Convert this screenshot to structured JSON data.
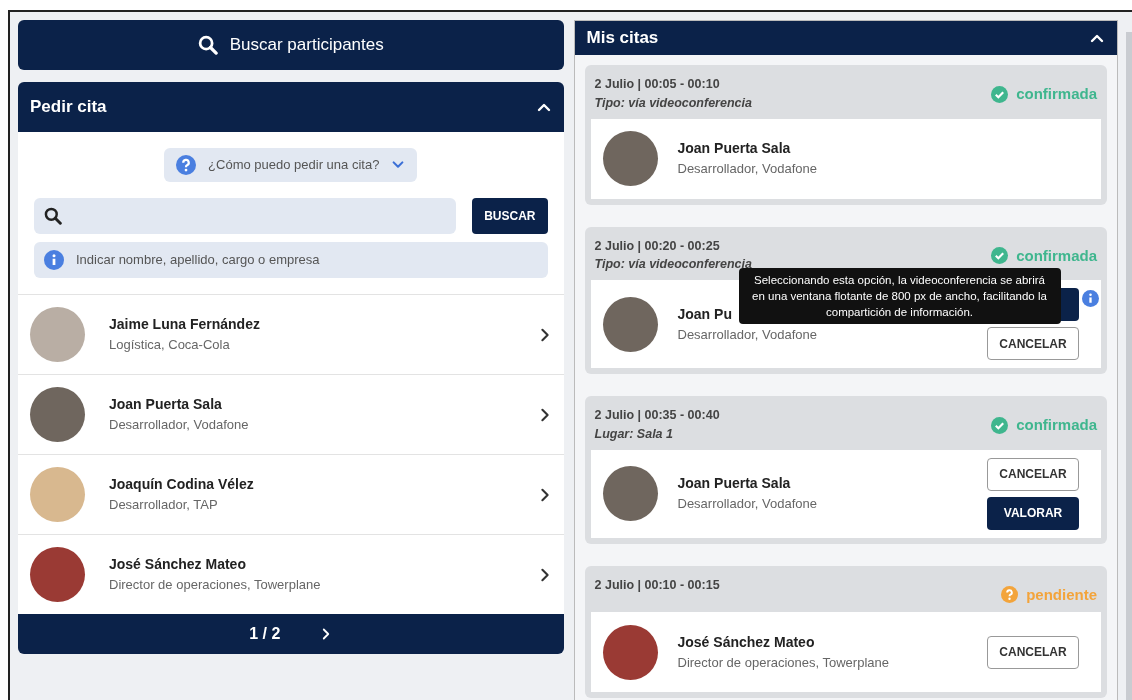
{
  "search_bar": {
    "label": "Buscar participantes"
  },
  "request_panel": {
    "title": "Pedir cita",
    "expanded": true,
    "help": {
      "label": "¿Cómo puedo pedir una cita?",
      "expanded": false
    },
    "search": {
      "button": "BUSCAR"
    },
    "hint": "Indicar nombre, apellido, cargo o empresa",
    "people": [
      {
        "name": "Jaime Luna Fernández",
        "role": "Logística, Coca-Cola"
      },
      {
        "name": "Joan Puerta Sala",
        "role": "Desarrollador, Vodafone"
      },
      {
        "name": "Joaquín Codina Vélez",
        "role": "Desarrollador, TAP"
      },
      {
        "name": "José Sánchez Mateo",
        "role": "Director de operaciones, Towerplane"
      }
    ],
    "pagination": {
      "page": "1 / 2"
    }
  },
  "appointments_panel": {
    "title": "Mis citas",
    "expanded": true,
    "appointments": [
      {
        "time": "2 Julio | 00:05 - 00:10",
        "detail": "Tipo: vía videoconferencia",
        "status": {
          "kind": "confirmed",
          "label": "confirmada"
        },
        "person": {
          "name": "Joan Puerta Sala",
          "role": "Desarrollador, Vodafone"
        }
      },
      {
        "time": "2 Julio | 00:20 - 00:25",
        "detail": "Tipo: vía videoconferencia",
        "status": {
          "kind": "confirmed",
          "label": "confirmada"
        },
        "person": {
          "name": "Joan Pu",
          "role": "Desarrollador, Vodafone"
        },
        "info_icon": true,
        "tooltip": "Seleccionando esta opción, la videoconferencia se abrirá en una ventana flotante de 800 px de ancho, facilitando la compartición de información.",
        "buttons": [
          {
            "kind": "primary"
          },
          {
            "kind": "outline",
            "label": "CANCELAR"
          }
        ]
      },
      {
        "time": "2 Julio | 00:35 - 00:40",
        "detail": "Lugar: Sala 1",
        "status": {
          "kind": "confirmed",
          "label": "confirmada"
        },
        "person": {
          "name": "Joan Puerta Sala",
          "role": "Desarrollador, Vodafone"
        },
        "buttons": [
          {
            "kind": "outline",
            "label": "CANCELAR"
          },
          {
            "kind": "primary",
            "label": "VALORAR"
          }
        ]
      },
      {
        "time": "2 Julio | 00:10 - 00:15",
        "status": {
          "kind": "pending",
          "label": "pendiente"
        },
        "person": {
          "name": "José Sánchez Mateo",
          "role": "Director de operaciones, Towerplane"
        },
        "buttons": [
          {
            "kind": "outline",
            "label": "CANCELAR"
          }
        ]
      }
    ]
  }
}
